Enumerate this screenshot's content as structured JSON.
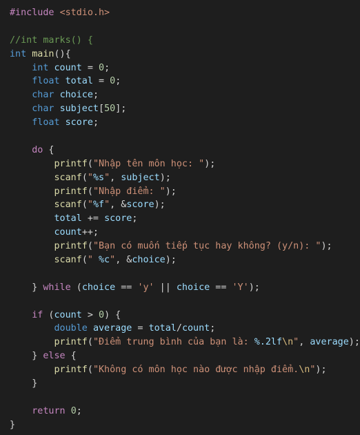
{
  "colors": {
    "background": "#1e1e1e",
    "default": "#d4d4d4",
    "keyword": "#569cd6",
    "control": "#c586c0",
    "function": "#dcdcaa",
    "variable": "#9cdcfe",
    "number": "#b5cea8",
    "string": "#ce9178",
    "comment": "#6a9955",
    "escape": "#d7ba7d"
  },
  "lines": [
    [
      [
        "control",
        "#include"
      ],
      [
        "default",
        " "
      ],
      [
        "string",
        "<stdio.h>"
      ]
    ],
    [],
    [
      [
        "comment",
        "//int marks() {"
      ]
    ],
    [
      [
        "keyword",
        "int"
      ],
      [
        "default",
        " "
      ],
      [
        "function",
        "main"
      ],
      [
        "default",
        "(){"
      ]
    ],
    [
      [
        "default",
        "    "
      ],
      [
        "keyword",
        "int"
      ],
      [
        "default",
        " "
      ],
      [
        "variable",
        "count"
      ],
      [
        "default",
        " = "
      ],
      [
        "number",
        "0"
      ],
      [
        "default",
        ";"
      ]
    ],
    [
      [
        "default",
        "    "
      ],
      [
        "keyword",
        "float"
      ],
      [
        "default",
        " "
      ],
      [
        "variable",
        "total"
      ],
      [
        "default",
        " = "
      ],
      [
        "number",
        "0"
      ],
      [
        "default",
        ";"
      ]
    ],
    [
      [
        "default",
        "    "
      ],
      [
        "keyword",
        "char"
      ],
      [
        "default",
        " "
      ],
      [
        "variable",
        "choice"
      ],
      [
        "default",
        ";"
      ]
    ],
    [
      [
        "default",
        "    "
      ],
      [
        "keyword",
        "char"
      ],
      [
        "default",
        " "
      ],
      [
        "variable",
        "subject"
      ],
      [
        "default",
        "["
      ],
      [
        "number",
        "50"
      ],
      [
        "default",
        "];"
      ]
    ],
    [
      [
        "default",
        "    "
      ],
      [
        "keyword",
        "float"
      ],
      [
        "default",
        " "
      ],
      [
        "variable",
        "score"
      ],
      [
        "default",
        ";"
      ]
    ],
    [],
    [
      [
        "default",
        "    "
      ],
      [
        "control",
        "do"
      ],
      [
        "default",
        " {"
      ]
    ],
    [
      [
        "default",
        "        "
      ],
      [
        "function",
        "printf"
      ],
      [
        "default",
        "("
      ],
      [
        "string",
        "\"Nhập tên môn học: \""
      ],
      [
        "default",
        ");"
      ]
    ],
    [
      [
        "default",
        "        "
      ],
      [
        "function",
        "scanf"
      ],
      [
        "default",
        "("
      ],
      [
        "string",
        "\""
      ],
      [
        "variable",
        "%s"
      ],
      [
        "string",
        "\""
      ],
      [
        "default",
        ", "
      ],
      [
        "variable",
        "subject"
      ],
      [
        "default",
        ");"
      ]
    ],
    [
      [
        "default",
        "        "
      ],
      [
        "function",
        "printf"
      ],
      [
        "default",
        "("
      ],
      [
        "string",
        "\"Nhập điểm: \""
      ],
      [
        "default",
        ");"
      ]
    ],
    [
      [
        "default",
        "        "
      ],
      [
        "function",
        "scanf"
      ],
      [
        "default",
        "("
      ],
      [
        "string",
        "\""
      ],
      [
        "variable",
        "%f"
      ],
      [
        "string",
        "\""
      ],
      [
        "default",
        ", &"
      ],
      [
        "variable",
        "score"
      ],
      [
        "default",
        ");"
      ]
    ],
    [
      [
        "default",
        "        "
      ],
      [
        "variable",
        "total"
      ],
      [
        "default",
        " += "
      ],
      [
        "variable",
        "score"
      ],
      [
        "default",
        ";"
      ]
    ],
    [
      [
        "default",
        "        "
      ],
      [
        "variable",
        "count"
      ],
      [
        "default",
        "++;"
      ]
    ],
    [
      [
        "default",
        "        "
      ],
      [
        "function",
        "printf"
      ],
      [
        "default",
        "("
      ],
      [
        "string",
        "\"Bạn có muốn tiếp tục hay không? (y/n): \""
      ],
      [
        "default",
        ");"
      ]
    ],
    [
      [
        "default",
        "        "
      ],
      [
        "function",
        "scanf"
      ],
      [
        "default",
        "("
      ],
      [
        "string",
        "\" "
      ],
      [
        "variable",
        "%c"
      ],
      [
        "string",
        "\""
      ],
      [
        "default",
        ", &"
      ],
      [
        "variable",
        "choice"
      ],
      [
        "default",
        ");"
      ]
    ],
    [],
    [
      [
        "default",
        "    } "
      ],
      [
        "control",
        "while"
      ],
      [
        "default",
        " ("
      ],
      [
        "variable",
        "choice"
      ],
      [
        "default",
        " == "
      ],
      [
        "string",
        "'y'"
      ],
      [
        "default",
        " || "
      ],
      [
        "variable",
        "choice"
      ],
      [
        "default",
        " == "
      ],
      [
        "string",
        "'Y'"
      ],
      [
        "default",
        ");"
      ]
    ],
    [],
    [
      [
        "default",
        "    "
      ],
      [
        "control",
        "if"
      ],
      [
        "default",
        " ("
      ],
      [
        "variable",
        "count"
      ],
      [
        "default",
        " > "
      ],
      [
        "number",
        "0"
      ],
      [
        "default",
        ") {"
      ]
    ],
    [
      [
        "default",
        "        "
      ],
      [
        "keyword",
        "double"
      ],
      [
        "default",
        " "
      ],
      [
        "variable",
        "average"
      ],
      [
        "default",
        " = "
      ],
      [
        "variable",
        "total"
      ],
      [
        "default",
        "/"
      ],
      [
        "variable",
        "count"
      ],
      [
        "default",
        ";"
      ]
    ],
    [
      [
        "default",
        "        "
      ],
      [
        "function",
        "printf"
      ],
      [
        "default",
        "("
      ],
      [
        "string",
        "\"Điểm trung bình của bạn là: "
      ],
      [
        "variable",
        "%.2lf"
      ],
      [
        "escape",
        "\\n"
      ],
      [
        "string",
        "\""
      ],
      [
        "default",
        ", "
      ],
      [
        "variable",
        "average"
      ],
      [
        "default",
        ");"
      ]
    ],
    [
      [
        "default",
        "    } "
      ],
      [
        "control",
        "else"
      ],
      [
        "default",
        " {"
      ]
    ],
    [
      [
        "default",
        "        "
      ],
      [
        "function",
        "printf"
      ],
      [
        "default",
        "("
      ],
      [
        "string",
        "\"Không có môn học nào được nhập điểm."
      ],
      [
        "escape",
        "\\n"
      ],
      [
        "string",
        "\""
      ],
      [
        "default",
        ");"
      ]
    ],
    [
      [
        "default",
        "    }"
      ]
    ],
    [],
    [
      [
        "default",
        "    "
      ],
      [
        "control",
        "return"
      ],
      [
        "default",
        " "
      ],
      [
        "number",
        "0"
      ],
      [
        "default",
        ";"
      ]
    ],
    [
      [
        "default",
        "}"
      ]
    ]
  ]
}
